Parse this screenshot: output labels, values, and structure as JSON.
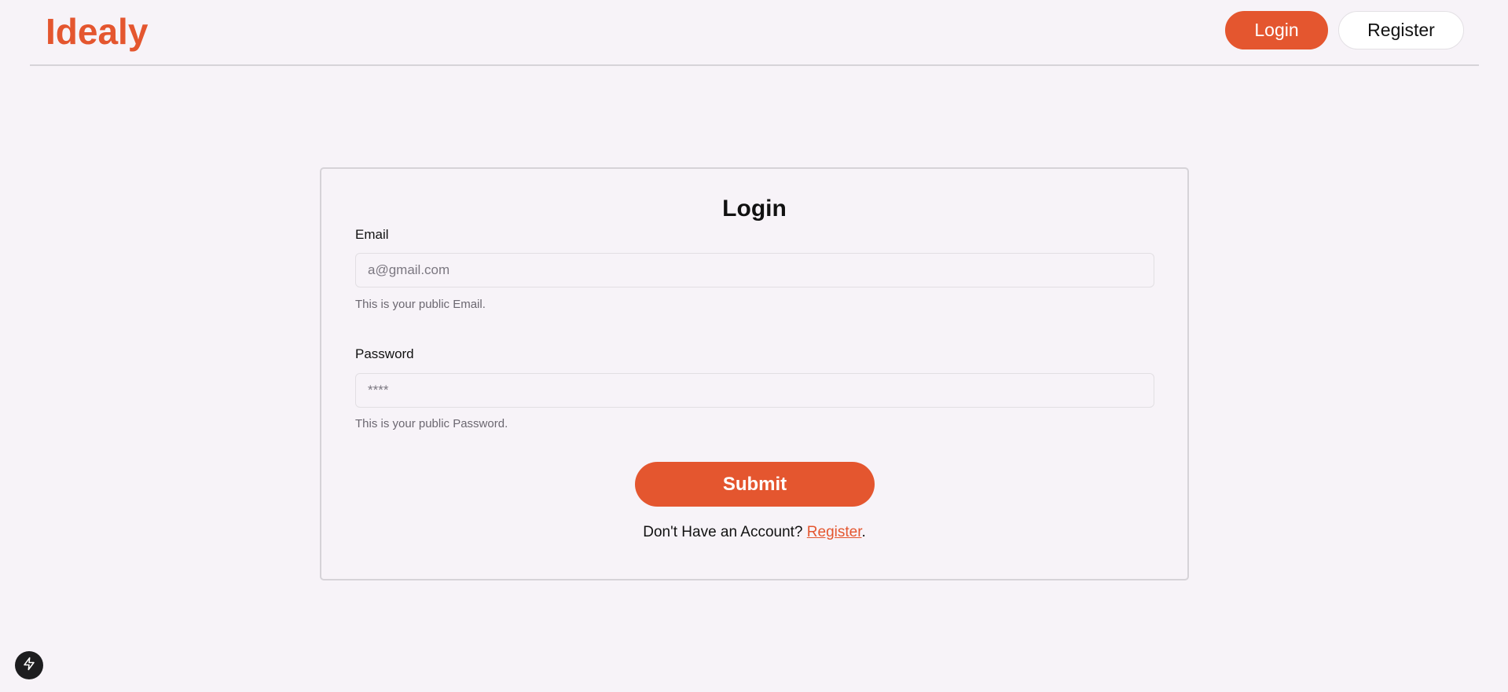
{
  "header": {
    "logo": "Idealy",
    "login_label": "Login",
    "register_label": "Register"
  },
  "form": {
    "title": "Login",
    "email": {
      "label": "Email",
      "placeholder": "a@gmail.com",
      "value": "",
      "help": "This is your public Email."
    },
    "password": {
      "label": "Password",
      "placeholder": "****",
      "value": "",
      "help": "This is your public Password."
    },
    "submit_label": "Submit",
    "footer": {
      "prompt": "Don't Have an Account? ",
      "link_label": "Register",
      "suffix": "."
    }
  },
  "dev_badge": {
    "icon": "lightning-bolt-icon"
  },
  "colors": {
    "accent": "#e4562f",
    "background": "#f7f3f8"
  }
}
